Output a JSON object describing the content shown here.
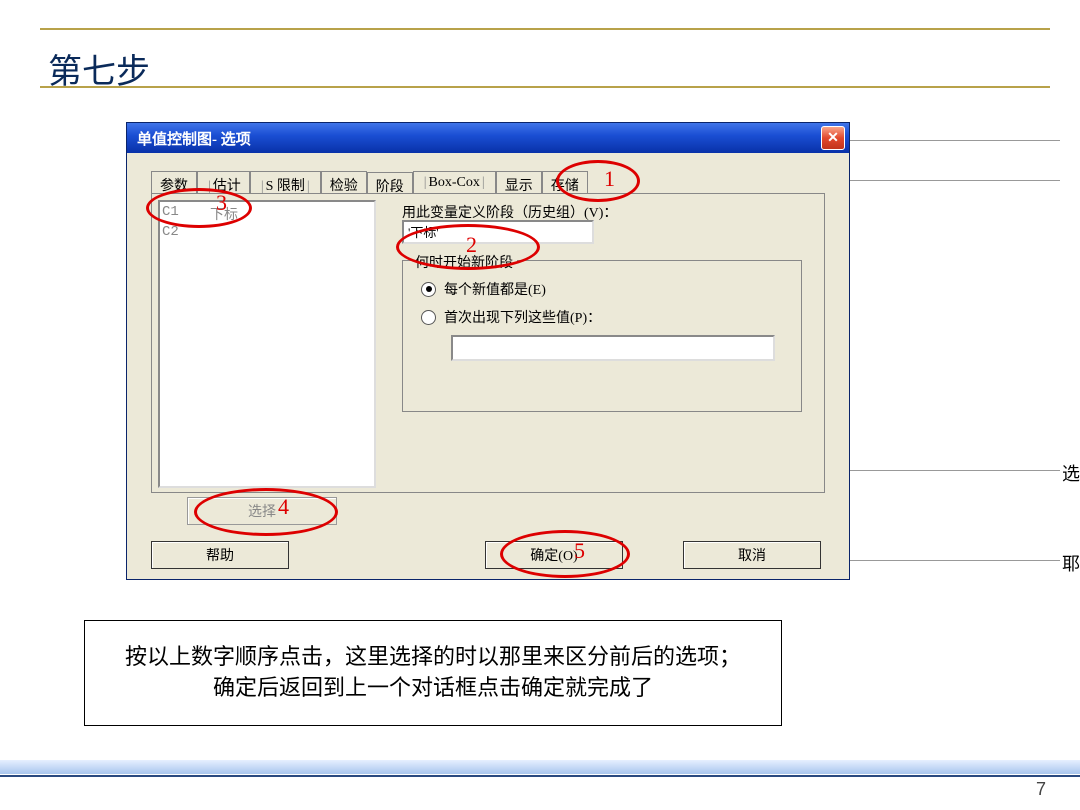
{
  "slide": {
    "title": "第七步",
    "page_number": "7"
  },
  "background": {
    "truncated_right_1": "选",
    "truncated_right_2": "耶"
  },
  "dialog": {
    "title": "单值控制图- 选项",
    "tabs": [
      "参数",
      "估计",
      "S 限制",
      "检验",
      "阶段",
      "Box-Cox",
      "显示",
      "存储"
    ],
    "listbox": {
      "rows": [
        {
          "col": "C1",
          "name": "下标"
        },
        {
          "col": "C2",
          "name": ""
        }
      ]
    },
    "var_label": "用此变量定义阶段（历史组）(V)：",
    "var_value": "'下标'",
    "group_title": "何时开始新阶段",
    "radio1": "每个新值都是(E)",
    "radio2": "首次出现下列这些值(P)：",
    "select_btn": "选择",
    "help_btn": "帮助",
    "ok_btn": "确定(O)",
    "cancel_btn": "取消"
  },
  "annotations": {
    "n1": "1",
    "n2": "2",
    "n3": "3",
    "n4": "4",
    "n5": "5"
  },
  "caption": {
    "line1": "按以上数字顺序点击，这里选择的时以那里来区分前后的选项；",
    "line2": "确定后返回到上一个对话框点击确定就完成了"
  }
}
